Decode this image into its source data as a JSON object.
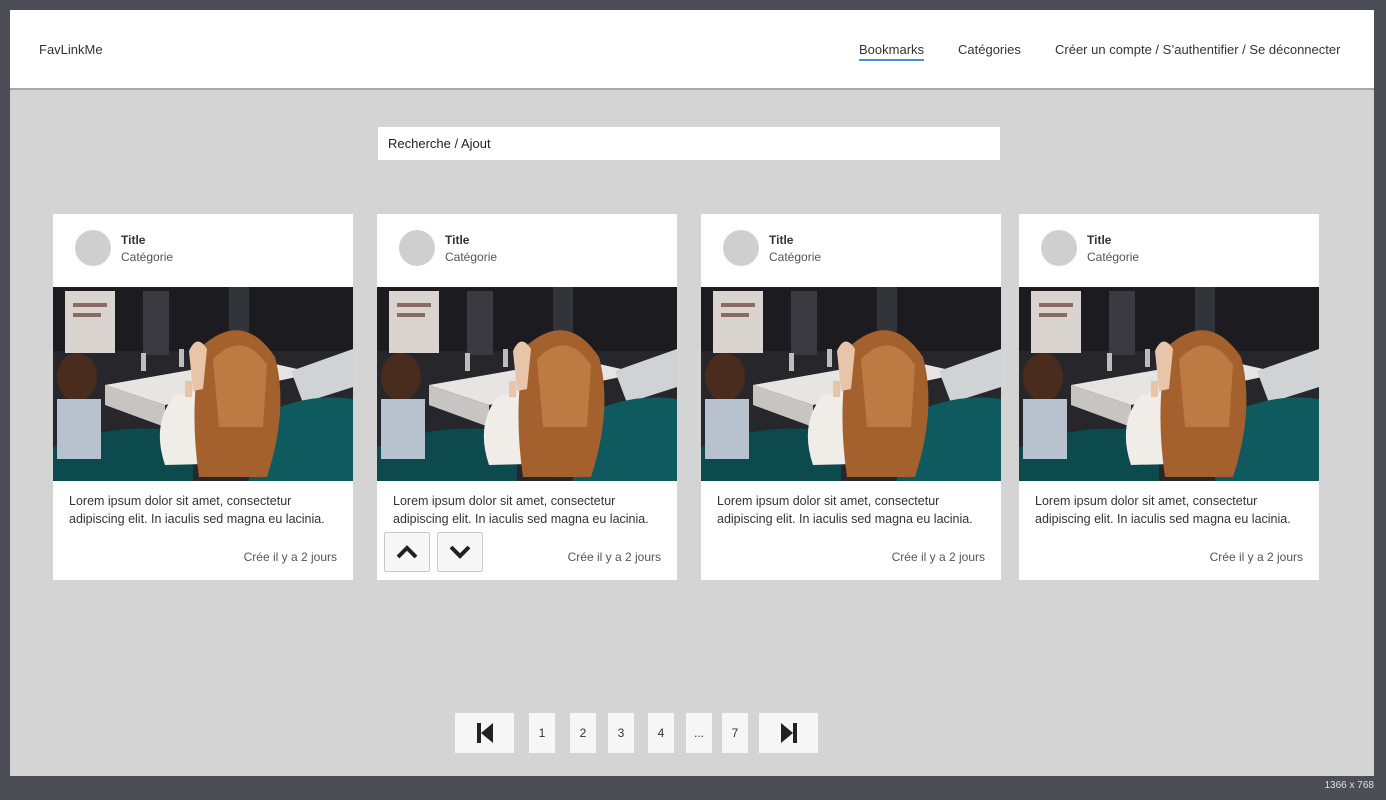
{
  "header": {
    "brand": "FavLinkMe",
    "nav": {
      "bookmarks": "Bookmarks",
      "categories": "Catégories",
      "account": "Créer un compte / S’authentifier / Se déconnecter"
    }
  },
  "search": {
    "placeholder": "Recherche / Ajout"
  },
  "cards": [
    {
      "title": "Title",
      "category": "Catégorie",
      "description": "Lorem ipsum dolor sit amet, consectetur adipiscing elit. In iaculis sed magna eu lacinia.",
      "date": "Crée il y a 2 jours"
    },
    {
      "title": "Title",
      "category": "Catégorie",
      "description": "Lorem ipsum dolor sit amet, consectetur adipiscing elit. In iaculis sed magna eu lacinia.",
      "date": "Crée il y a 2 jours"
    },
    {
      "title": "Title",
      "category": "Catégorie",
      "description": "Lorem ipsum dolor sit amet, consectetur adipiscing elit. In iaculis sed magna eu lacinia.",
      "date": "Crée il y a 2 jours"
    },
    {
      "title": "Title",
      "category": "Catégorie",
      "description": "Lorem ipsum dolor sit amet, consectetur adipiscing elit. In iaculis sed magna eu lacinia.",
      "date": "Crée il y a 2 jours"
    }
  ],
  "vote_icons": {
    "up": "chevron-up-icon",
    "down": "chevron-down-icon"
  },
  "pagination": {
    "first_icon": "skip-first-icon",
    "last_icon": "skip-last-icon",
    "pages": [
      "1",
      "2",
      "3",
      "4",
      "...",
      "7"
    ]
  },
  "screen_size": "1366 x 768",
  "colors": {
    "accent": "#4a90d9",
    "background": "#d4d4d4",
    "frame": "#4d4d55"
  }
}
